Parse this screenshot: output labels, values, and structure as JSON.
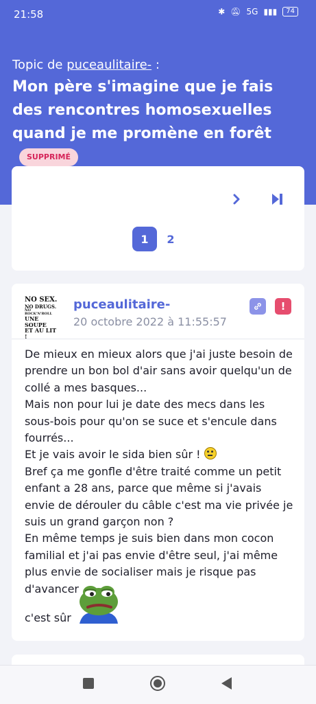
{
  "status_bar": {
    "time": "21:58",
    "network": "5G",
    "battery": "74"
  },
  "topic": {
    "prefix": "Topic de",
    "author": "puceaulitaire-",
    "suffix": ":",
    "title": "Mon père s'imagine que je fais des rencontres homosexuelles quand je me promène en forêt",
    "badge": "SUPPRIMÉ"
  },
  "pagination": {
    "pages": [
      "1",
      "2"
    ],
    "current": "1"
  },
  "post": {
    "avatar_text": [
      "NO SEX.",
      "NO DRUGS.",
      "NO ROCK'N'ROLL",
      "UNE SOUPE",
      "ET AU LIT !"
    ],
    "author": "puceaulitaire-",
    "date": "20 octobre 2022 à 11:55:57",
    "lines": [
      "De mieux en mieux alors que j'ai juste besoin de prendre un bon bol d'air sans avoir quelqu'un de collé a mes basques...",
      "Mais non pour lui je date des mecs dans les sous-bois pour qu'on se suce et s'encule dans fourrés...",
      "Et je vais avoir le sida bien sûr !",
      "Bref ça me gonfle d'être traité comme un petit enfant a 28 ans, parce que même si j'avais envie de dérouler du câble c'est ma vie privée je suis un grand garçon non ?",
      "En même temps je suis bien dans mon cocon familial et j'ai pas envie d'être seul, j'ai même plus envie de socialiser mais je risque pas d'avancer"
    ],
    "last_line": "c'est sûr"
  },
  "colors": {
    "accent": "#5468d8",
    "badge_bg": "#f9d5dc",
    "badge_text": "#d6265a",
    "report": "#e64d6e"
  }
}
